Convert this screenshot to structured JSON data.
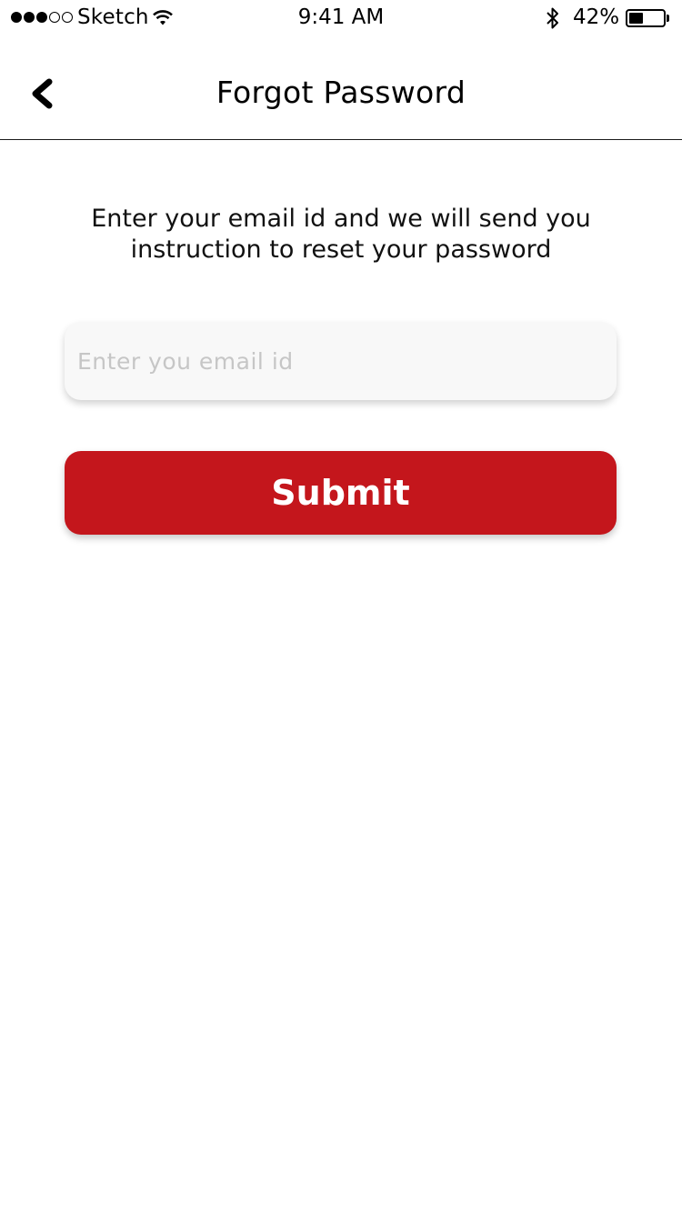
{
  "status_bar": {
    "carrier": "Sketch",
    "signal_strength": 3,
    "signal_total": 5,
    "time": "9:41 AM",
    "battery_percent_label": "42%",
    "battery_level": 0.42
  },
  "nav": {
    "back_icon": "chevron-left-icon",
    "title": "Forgot Password"
  },
  "content": {
    "instruction": "Enter your email id and we will send you instruction to reset your password",
    "email_placeholder": "Enter you email id",
    "email_value": "",
    "submit_label": "Submit"
  },
  "colors": {
    "accent": "#c4161c",
    "field_background": "#f8f8f8",
    "placeholder": "#c6c6c6"
  }
}
